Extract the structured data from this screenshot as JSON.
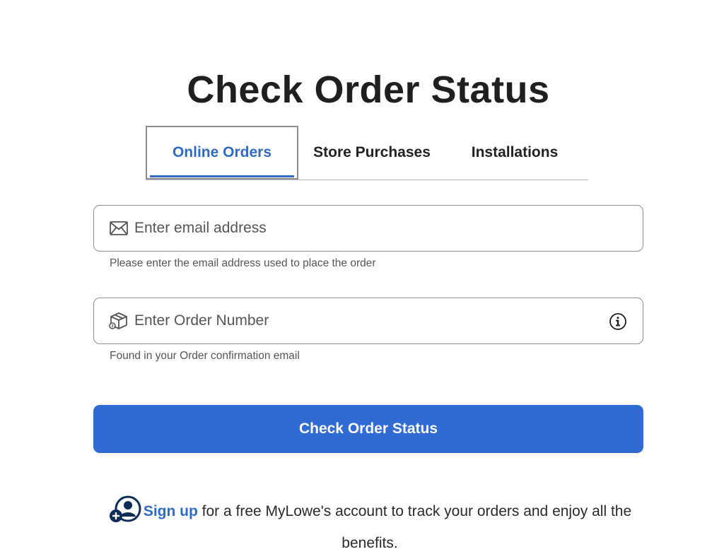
{
  "page": {
    "title": "Check Order Status"
  },
  "tabs": [
    {
      "label": "Online Orders",
      "active": true
    },
    {
      "label": "Store Purchases",
      "active": false
    },
    {
      "label": "Installations",
      "active": false
    }
  ],
  "email": {
    "value": "",
    "placeholder": "Enter email address",
    "helper": "Please enter the email address used to place the order",
    "icon": "envelope-icon"
  },
  "order_number": {
    "value": "",
    "placeholder": "Enter Order Number",
    "helper": "Found in your Order confirmation email",
    "icon": "package-icon",
    "trailing_icon": "info-icon"
  },
  "submit": {
    "label": "Check Order Status"
  },
  "signup": {
    "link_label": "Sign up",
    "text": " for a free MyLowe's account to track your orders and enjoy all the benefits.",
    "icon": "add-user-icon"
  },
  "colors": {
    "accent": "#2f6bc2",
    "button": "#2f6bd3",
    "text": "#1f1f1f",
    "border": "#8e8e8e"
  }
}
